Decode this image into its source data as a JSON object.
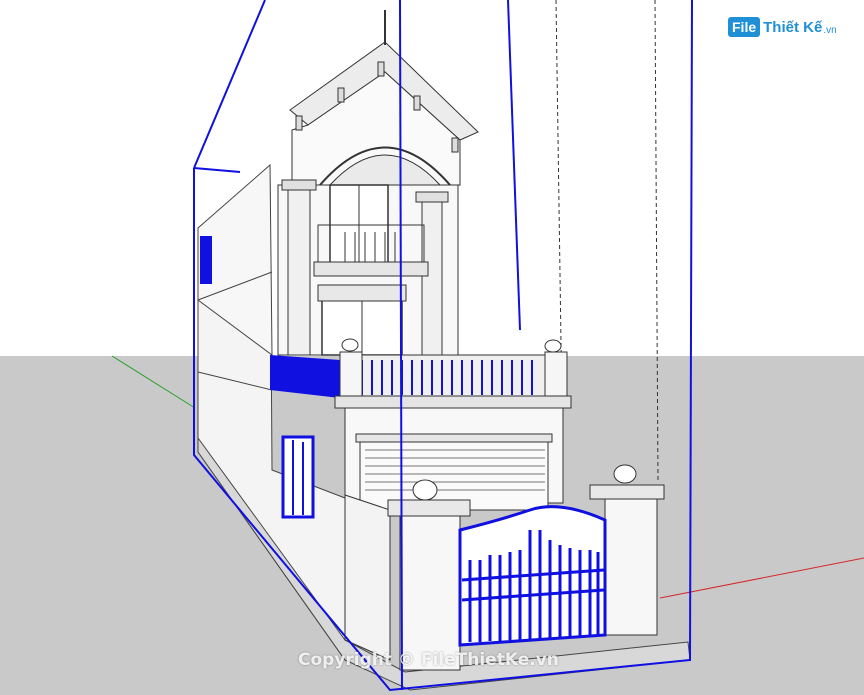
{
  "logo": {
    "box": "File",
    "main": "Thiết Kế",
    "suffix": ".vn"
  },
  "watermark": "Copyright © FileThietKe.vn",
  "colors": {
    "ground": "#c9c9c9",
    "selection_blue": "#1010e0",
    "axis_green": "#2ca02c",
    "axis_red": "#d62728",
    "line_gray": "#555555",
    "logo_blue": "#1f8fd6"
  }
}
